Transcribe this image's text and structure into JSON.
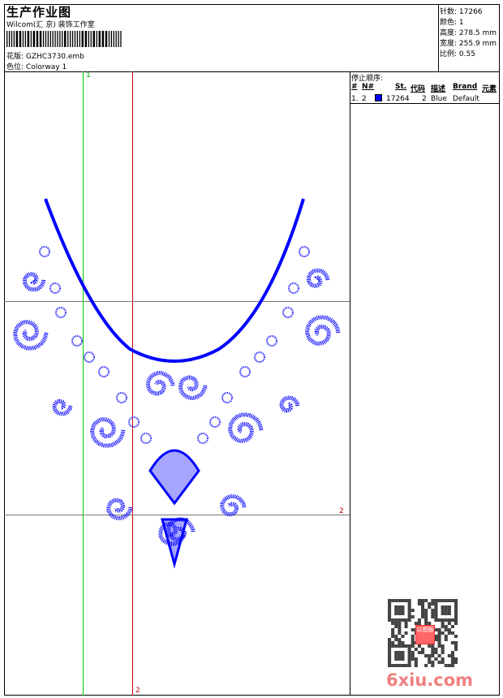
{
  "header": {
    "title": "生产作业图",
    "company": "Wilcom(汇 京) 装饰工作室",
    "design_label": "花版:",
    "design_value": "GZHC3730.emb",
    "colorway_label": "色位:",
    "colorway_value": "Colorway 1"
  },
  "info": {
    "stitches": "针数: 17266",
    "colors": "颜色: 1",
    "height": "高度: 278.5 mm",
    "width": "宽度: 255.9 mm",
    "scale": "比例: 0.55"
  },
  "stop_sequence": {
    "title": "停止顺序:",
    "columns": [
      "#",
      "N#",
      "St.",
      "代码",
      "描述",
      "Brand",
      "元素"
    ],
    "rows": [
      {
        "index": "1.",
        "needle": "2",
        "color": "#0000ff",
        "stitches": "17264",
        "code": "2",
        "description": "Blue",
        "brand": "Default",
        "element": ""
      }
    ]
  },
  "guides": {
    "label_top": "1",
    "label_right": "2",
    "label_bottom": "2",
    "guide_color_green": "#00cc00",
    "guide_color_red": "#cc0000"
  },
  "design": {
    "thread_color": "#0000ff"
  },
  "watermark": {
    "text": "6xiu.com",
    "seal": "以图版"
  }
}
